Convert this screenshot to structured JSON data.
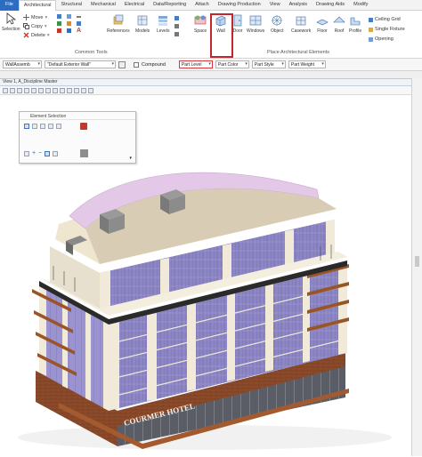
{
  "ribbon_tabs": [
    {
      "label": "File",
      "style": "file"
    },
    {
      "label": "Architectural",
      "style": "active"
    },
    {
      "label": "Structural",
      "style": ""
    },
    {
      "label": "Mechanical",
      "style": ""
    },
    {
      "label": "Electrical",
      "style": ""
    },
    {
      "label": "Data/Reporting",
      "style": ""
    },
    {
      "label": "Attach",
      "style": ""
    },
    {
      "label": "Drawing Production",
      "style": ""
    },
    {
      "label": "View",
      "style": ""
    },
    {
      "label": "Analysis",
      "style": ""
    },
    {
      "label": "Drawing Aids",
      "style": ""
    },
    {
      "label": "Modify",
      "style": ""
    }
  ],
  "ribbon": {
    "selection_label": "Selection",
    "move_label": "Move",
    "copy_label": "Copy",
    "delete_label": "Delete",
    "references_label": "References",
    "models_label": "Models",
    "levels_label": "Levels",
    "common_tools_label": "Common Tools",
    "space_label": "Space",
    "wall_label": "Wall",
    "door_label": "Door",
    "window_label": "Windows",
    "object_label": "Object",
    "casework_label": "Casework",
    "floor_label": "Floor",
    "roof_label": "Roof",
    "profile_label": "Profile",
    "ceiling_grid_label": "Ceiling Grid",
    "single_fixture_label": "Single Fixture",
    "opening_label": "Opening",
    "place_arch_label": "Place Architectural Elements"
  },
  "propbar": {
    "wall_assembly": "WallAssemb",
    "default_wall": "\"Default Exterior Wall\"",
    "compound_label": "Compound",
    "part_level": "Part Level",
    "part_color": "Part Color",
    "part_style": "Part Style",
    "part_weight": "Part Weight"
  },
  "view": {
    "title": "View 1, A_Discipline Master"
  },
  "element_selection": {
    "title": "Element Selection"
  },
  "building_sign": "COURMER  HOTEL",
  "colors": {
    "accent": "#2b6cc4",
    "highlight_red": "#c1272d",
    "roof_pink": "#e4c8e8",
    "glass_purple": "#8d86c4",
    "facade_cream": "#f1ead9",
    "brick_brown": "#8b4a2a"
  }
}
